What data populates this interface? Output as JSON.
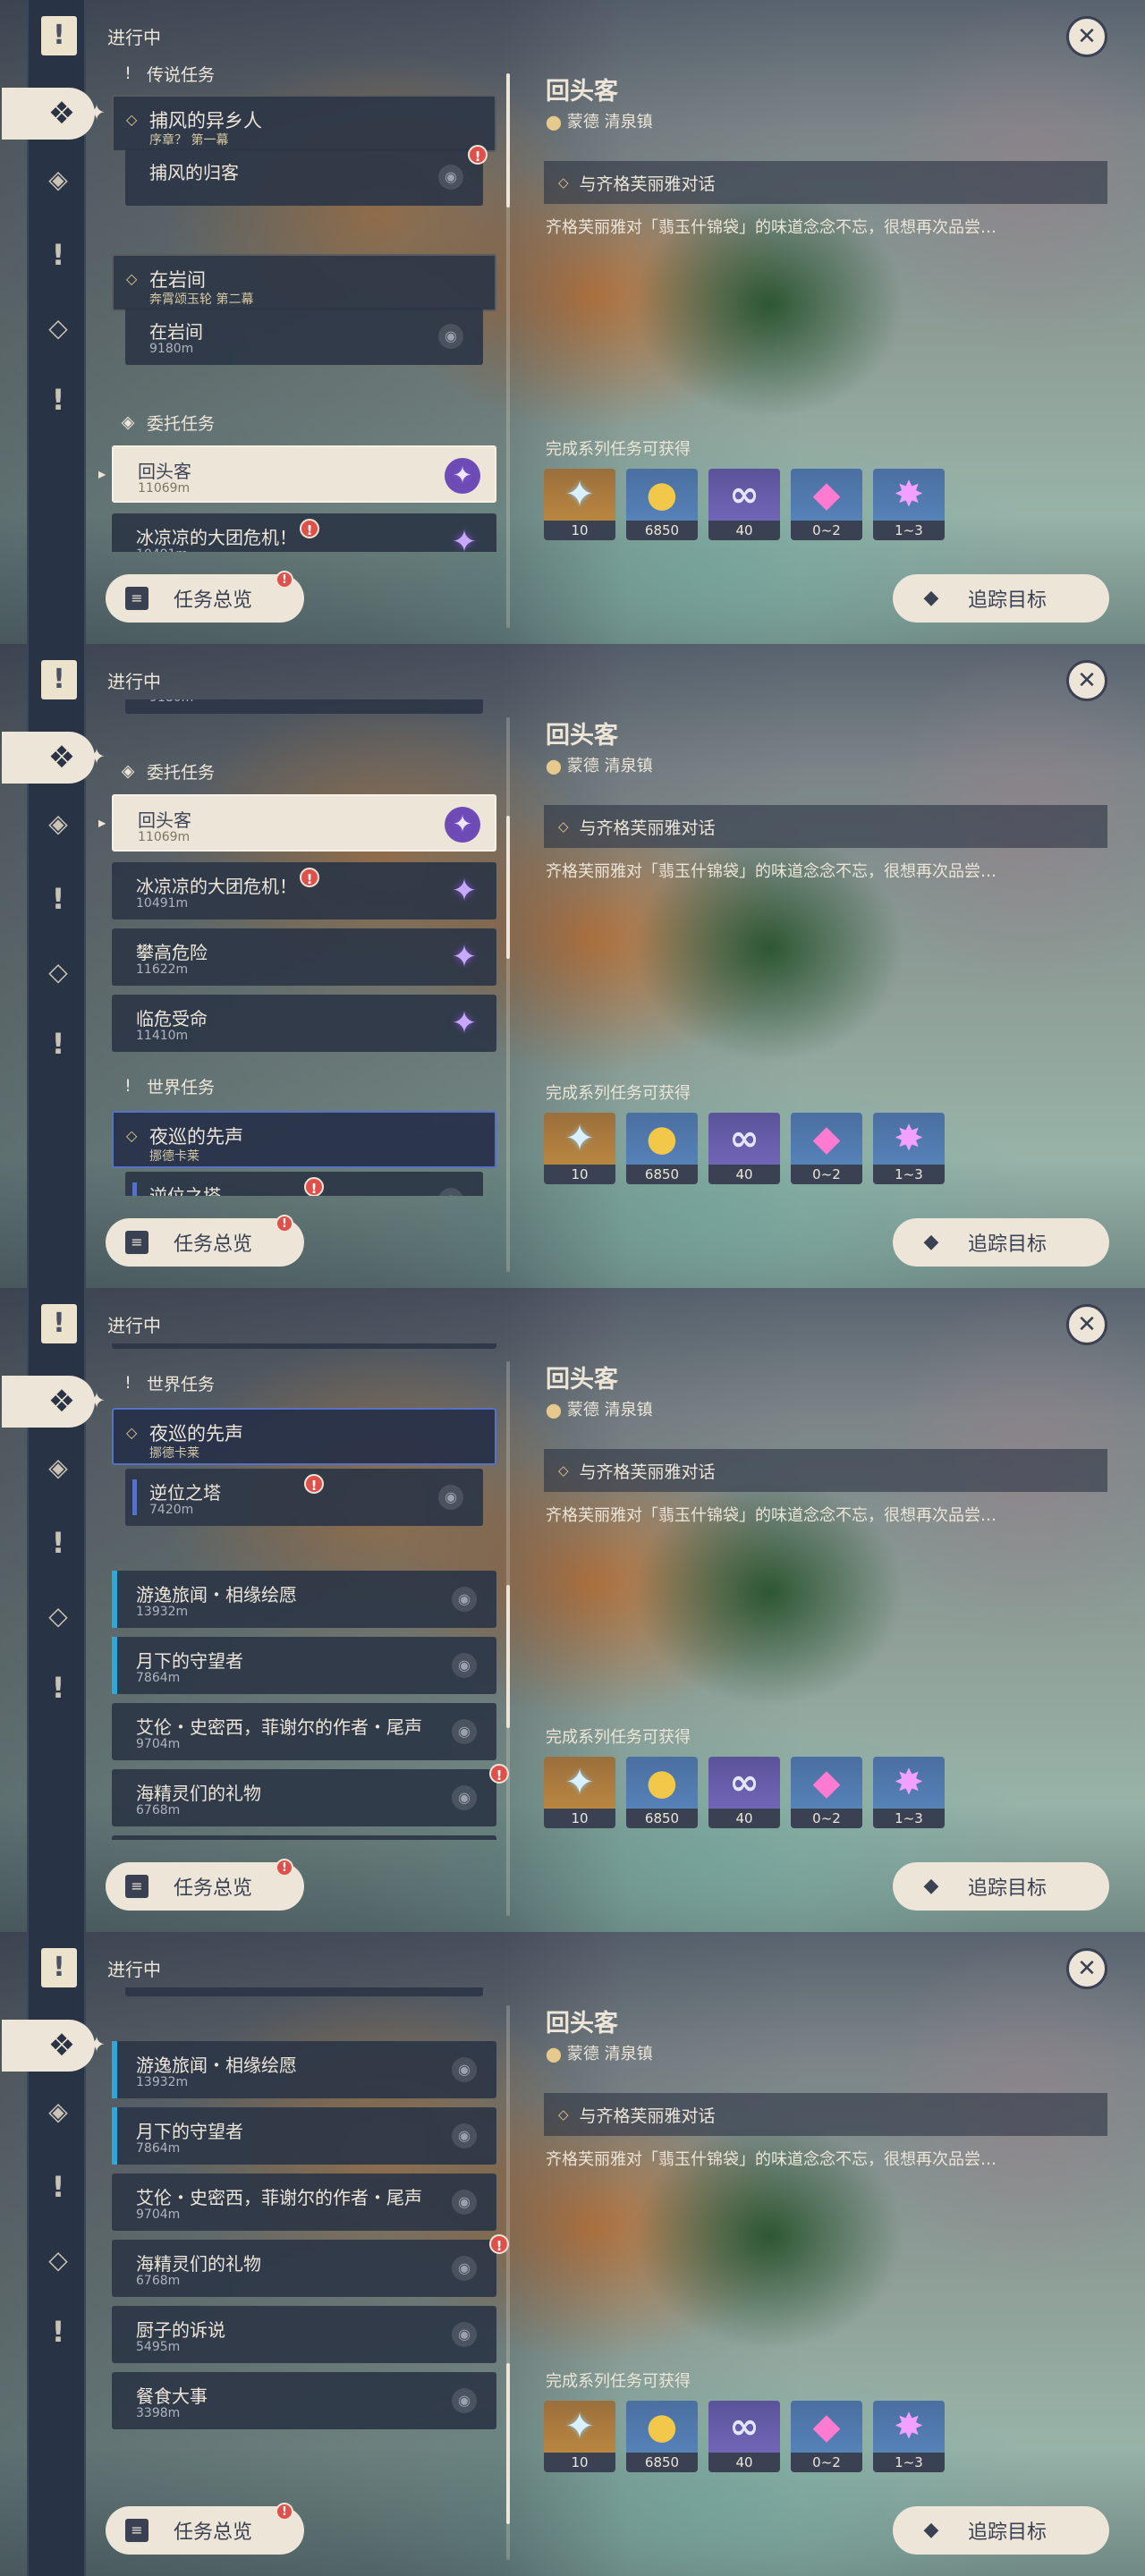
{
  "status_title": "进行中",
  "sidebar": {
    "icons": [
      "quest-book-icon",
      "quest-all-icon",
      "archon-quest-icon",
      "legend-quest-icon",
      "commission-quest-icon",
      "world-quest-icon"
    ]
  },
  "buttons": {
    "overview": "任务总览",
    "track": "追踪目标"
  },
  "detail": {
    "title": "回头客",
    "location": "蒙德 清泉镇",
    "objective": "与齐格芙丽雅对话",
    "description": "齐格芙丽雅对「翡玉什锦袋」的味道念念不忘，很想再次品尝…",
    "rewards_label": "完成系列任务可获得",
    "rewards": [
      {
        "icon": "adventure-exp-icon",
        "label": "10"
      },
      {
        "icon": "mora-icon",
        "label": "6850"
      },
      {
        "icon": "companionship-exp-icon",
        "label": "40"
      },
      {
        "icon": "primogem-crystal-icon",
        "label": "0~2"
      },
      {
        "icon": "crystal-chunk-icon",
        "label": "1~3"
      }
    ]
  },
  "sections": {
    "legend": "传说任务",
    "commission": "委托任务",
    "world": "世界任务"
  },
  "quests": {
    "legend1": {
      "title": "捕风的异乡人",
      "subtitle": "序章？ 第一幕"
    },
    "legend1_step": {
      "title": "捕风的归客"
    },
    "legend2": {
      "title": "在岩间",
      "subtitle": "奔霄颂玉轮 第二幕"
    },
    "legend2_step": {
      "title": "在岩间",
      "distance": "9180m"
    },
    "c1": {
      "title": "回头客",
      "distance": "11069m"
    },
    "c2": {
      "title": "冰凉凉的大团危机！",
      "distance": "10491m"
    },
    "c3": {
      "title": "攀高危险",
      "distance": "11622m"
    },
    "c4": {
      "title": "临危受命",
      "distance": "11410m"
    },
    "world1": {
      "title": "夜巡的先声",
      "subtitle": "挪德卡莱"
    },
    "world1_step": {
      "title": "逆位之塔",
      "distance": "7420m"
    },
    "w2": {
      "title": "游逸旅闻・相缘绘愿",
      "distance": "13932m"
    },
    "w3": {
      "title": "月下的守望者",
      "distance": "7864m"
    },
    "w4": {
      "title": "艾伦・史密西，菲谢尔的作者・尾声",
      "distance": "9704m"
    },
    "w5": {
      "title": "海精灵们的礼物",
      "distance": "6768m"
    },
    "w6": {
      "title": "厨子的诉说",
      "distance": "5495m"
    },
    "w7": {
      "title": "餐食大事",
      "distance": "3398m"
    }
  },
  "colors": {
    "panel": "#283346",
    "cream": "#ece5d8",
    "alert": "#e0504a",
    "gold": "#e5c98d",
    "world_stripe": "#2ea8d8"
  }
}
